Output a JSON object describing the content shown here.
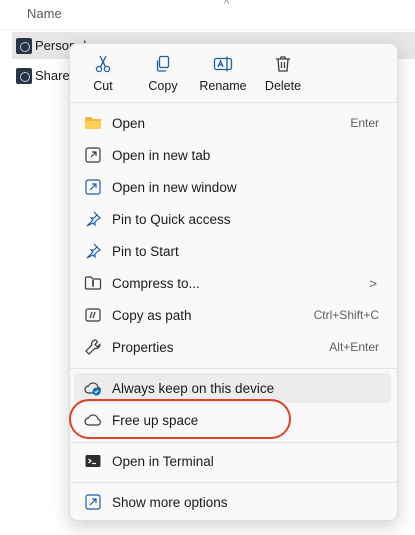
{
  "explorer": {
    "column_name": "Name",
    "sort_caret": "^",
    "rows": [
      {
        "label": "Personal"
      },
      {
        "label": "Shares"
      }
    ]
  },
  "menu": {
    "quick_actions": [
      {
        "label": "Cut",
        "icon": "scissors-icon"
      },
      {
        "label": "Copy",
        "icon": "copy-icon"
      },
      {
        "label": "Rename",
        "icon": "rename-icon"
      },
      {
        "label": "Delete",
        "icon": "trash-icon"
      }
    ],
    "items": [
      {
        "label": "Open",
        "shortcut": "Enter",
        "icon": "folder-icon"
      },
      {
        "label": "Open in new tab",
        "shortcut": "",
        "icon": "new-tab-icon"
      },
      {
        "label": "Open in new window",
        "shortcut": "",
        "icon": "new-window-icon"
      },
      {
        "label": "Pin to Quick access",
        "shortcut": "",
        "icon": "pin-icon"
      },
      {
        "label": "Pin to Start",
        "shortcut": "",
        "icon": "pin-icon"
      },
      {
        "label": "Compress to...",
        "shortcut": "",
        "icon": "zip-folder-icon",
        "submenu": ">"
      },
      {
        "label": "Copy as path",
        "shortcut": "Ctrl+Shift+C",
        "icon": "copy-path-icon"
      },
      {
        "label": "Properties",
        "shortcut": "Alt+Enter",
        "icon": "wrench-icon"
      },
      {
        "label": "Always keep on this device",
        "shortcut": "",
        "icon": "cloud-sync-icon"
      },
      {
        "label": "Free up space",
        "shortcut": "",
        "icon": "cloud-icon"
      },
      {
        "label": "Open in Terminal",
        "shortcut": "",
        "icon": "terminal-icon"
      },
      {
        "label": "Show more options",
        "shortcut": "",
        "icon": "more-options-icon"
      }
    ]
  },
  "colors": {
    "accent": "#0f6cbd",
    "highlight_ring": "#e0412a",
    "menu_bg": "#f9f9f9"
  }
}
